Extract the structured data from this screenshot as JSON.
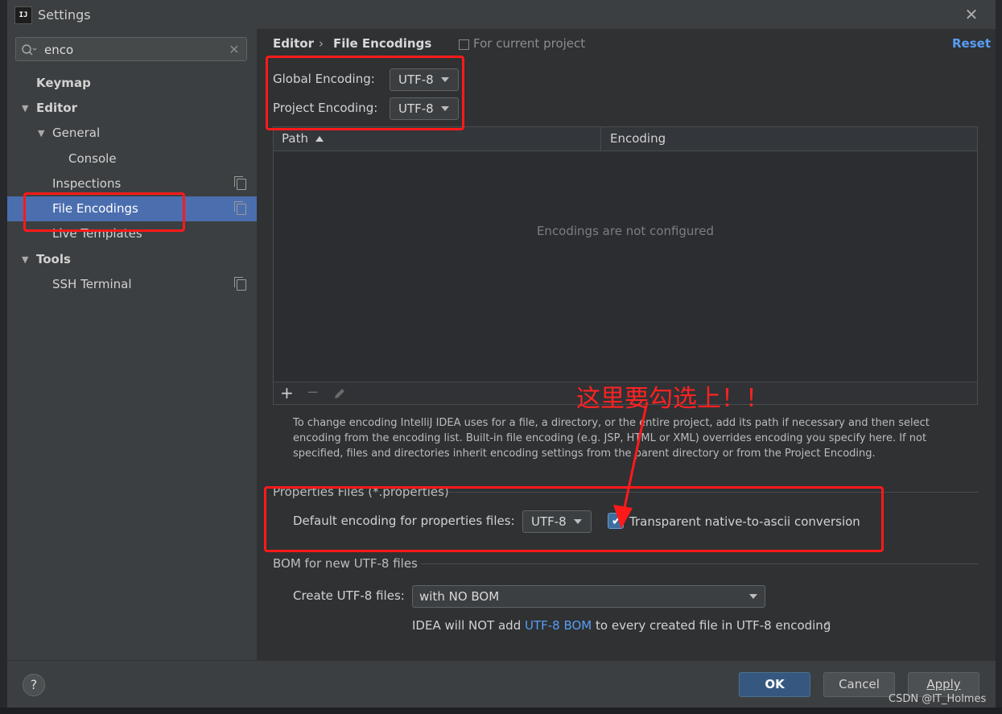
{
  "window": {
    "title": "Settings"
  },
  "search": {
    "value": "enco"
  },
  "sidebar": {
    "items": [
      {
        "label": "Keymap"
      },
      {
        "label": "Editor"
      },
      {
        "label": "General"
      },
      {
        "label": "Console"
      },
      {
        "label": "Inspections"
      },
      {
        "label": "File Encodings"
      },
      {
        "label": "Live Templates"
      },
      {
        "label": "Tools"
      },
      {
        "label": "SSH Terminal"
      }
    ]
  },
  "breadcrumb": {
    "parent": "Editor",
    "separator": "›",
    "current": "File Encodings",
    "scope": "For current project"
  },
  "reset_label": "Reset",
  "global_encoding": {
    "label": "Global Encoding:",
    "value": "UTF-8"
  },
  "project_encoding": {
    "label": "Project Encoding:",
    "value": "UTF-8"
  },
  "table": {
    "columns": [
      "Path",
      "Encoding"
    ],
    "empty_text": "Encodings are not configured"
  },
  "help_text": "To change encoding IntelliJ IDEA uses for a file, a directory, or the entire project, add its path if necessary and then select encoding from the encoding list. Built-in file encoding (e.g. JSP, HTML or XML) overrides encoding you specify here. If not specified, files and directories inherit encoding settings from the parent directory or from the Project Encoding.",
  "properties": {
    "section_title": "Properties Files (*.properties)",
    "default_label": "Default encoding for properties files:",
    "default_value": "UTF-8",
    "checkbox_label": "Transparent native-to-ascii conversion",
    "checkbox_checked": true
  },
  "bom": {
    "section_title": "BOM for new UTF-8 files",
    "create_label": "Create UTF-8 files:",
    "create_value": "with NO BOM",
    "note_prefix": "IDEA will NOT add ",
    "note_link": "UTF-8 BOM",
    "note_suffix": " to every created file in UTF-8 encoding"
  },
  "annotation": {
    "text": "这里要勾选上！！",
    "color": "#ff1a1a"
  },
  "buttons": {
    "ok": "OK",
    "cancel": "Cancel",
    "apply": "Apply",
    "help": "?"
  },
  "watermark": "CSDN @IT_Holmes",
  "colors": {
    "accent": "#4b6eaf",
    "link": "#589df6",
    "ok": "#365880"
  }
}
